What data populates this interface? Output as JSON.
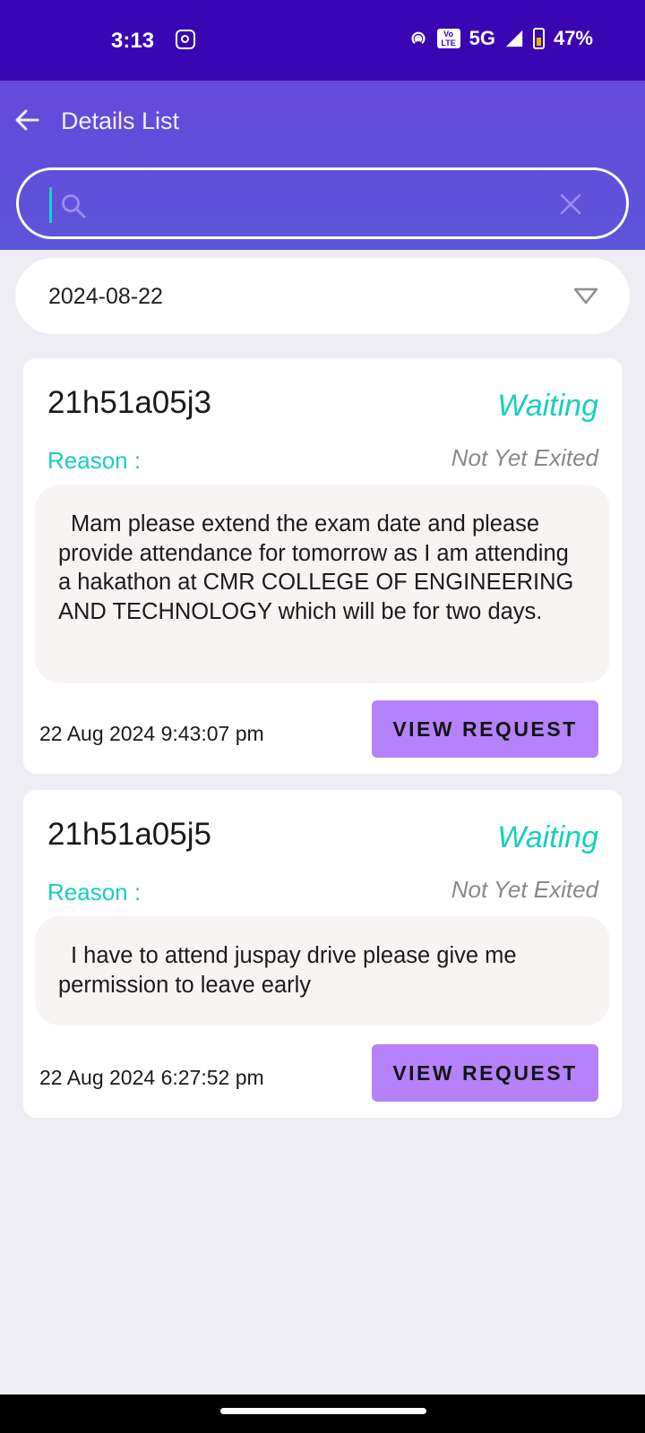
{
  "status_bar": {
    "time": "3:13",
    "network": "5G",
    "volte_line1": "Vo",
    "volte_line2": "LTE",
    "battery": "47%"
  },
  "header": {
    "title": "Details List",
    "back_icon": "arrow-left-icon"
  },
  "search": {
    "value": "",
    "placeholder": "",
    "search_icon": "search-icon",
    "clear_icon": "close-icon"
  },
  "date_filter": {
    "selected": "2024-08-22",
    "icon": "triangle-down-icon"
  },
  "requests": [
    {
      "id": "21h51a05j3",
      "status": "Waiting",
      "reason_label": "Reason :",
      "exit_status": "Not Yet Exited",
      "reason": "Mam please extend the exam date and please provide attendance for tomorrow as I am attending a hakathon at CMR COLLEGE OF ENGINEERING AND TECHNOLOGY which will be for two days.",
      "timestamp": "22 Aug 2024 9:43:07 pm",
      "button_label": "VIEW REQUEST"
    },
    {
      "id": "21h51a05j5",
      "status": "Waiting",
      "reason_label": "Reason :",
      "exit_status": "Not Yet Exited",
      "reason": "I have to attend juspay drive please give me permission to leave early",
      "timestamp": "22 Aug 2024 6:27:52 pm",
      "button_label": "VIEW REQUEST"
    }
  ],
  "colors": {
    "status_bar": "#3a06b4",
    "header": "#6549dd",
    "accent_teal": "#15cfc2",
    "button": "#b682fb",
    "background": "#efedf4"
  }
}
